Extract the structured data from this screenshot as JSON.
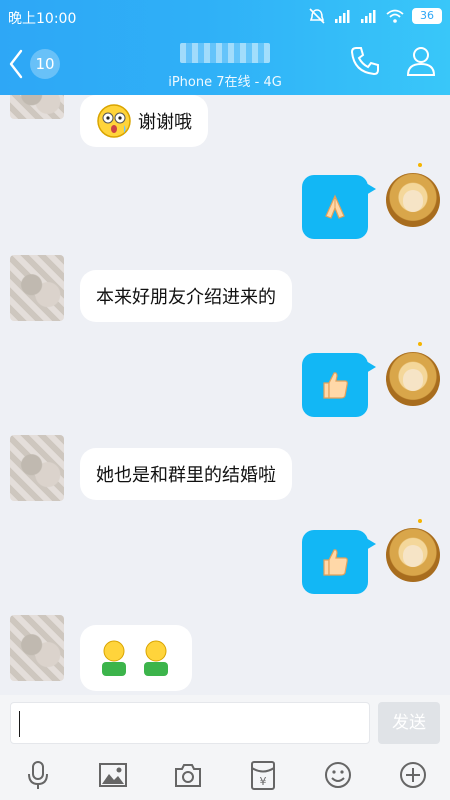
{
  "status": {
    "time": "晚上10:00",
    "battery": "36"
  },
  "header": {
    "unread_count": "10",
    "subtitle": "iPhone 7在线 - 4G"
  },
  "messages": [
    {
      "side": "left",
      "text": "谢谢哦",
      "emoji": "shocked-face"
    },
    {
      "side": "right",
      "emoji": "pray-hands"
    },
    {
      "side": "left",
      "text": "本来好朋友介绍进来的"
    },
    {
      "side": "right",
      "emoji": "thumbs-up"
    },
    {
      "side": "left",
      "text": "她也是和群里的结婚啦"
    },
    {
      "side": "right",
      "emoji": "thumbs-up"
    },
    {
      "side": "left",
      "emoji": "two-people"
    }
  ],
  "composer": {
    "send_label": "发送"
  },
  "toolbar": [
    "microphone-icon",
    "image-icon",
    "camera-icon",
    "red-envelope-icon",
    "emoji-icon",
    "plus-icon"
  ],
  "colors": {
    "header_start": "#2ea7f6",
    "header_end": "#39c7f9",
    "bubble_self": "#12b7f5",
    "bubble_other": "#ffffff",
    "background": "#eef0f5"
  }
}
